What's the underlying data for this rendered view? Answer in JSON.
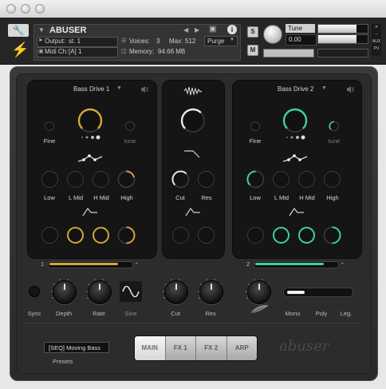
{
  "header": {
    "instrument": "ABUSER",
    "output_label": "Output:",
    "output_value": "st. 1",
    "midi_label": "Midi Ch:",
    "midi_value": "[A] 1",
    "voices_label": "Voices:",
    "voices_value": "3",
    "max_label": "Max:",
    "max_value": "512",
    "memory_label": "Memory:",
    "memory_value": "94.66 MB",
    "purge": "Purge",
    "tune_label": "Tune",
    "tune_value": "0.00",
    "s_btn": "S",
    "m_btn": "M",
    "aux": "AUX",
    "pv": "PV"
  },
  "panels": {
    "left": {
      "title": "Bass Drive 1",
      "fine": "Fine",
      "tune": "tune",
      "low": "Low",
      "lmid": "L Mid",
      "hmid": "H Mid",
      "high": "High",
      "accent": "#d6a53a"
    },
    "middle": {
      "cut": "Cut",
      "res": "Res"
    },
    "right": {
      "title": "Bass Drive 2",
      "fine": "Fine",
      "tune": "tune",
      "low": "Low",
      "lmid": "L Mid",
      "hmid": "H Mid",
      "high": "High",
      "accent": "#3fcfa3"
    }
  },
  "sliders": {
    "left_num": "1",
    "right_num": "2",
    "left_level": 0.85,
    "right_level": 0.85
  },
  "controls": {
    "sync": "Sync",
    "depth": "Depth",
    "rate": "Rate",
    "sine": "Sine",
    "cut": "Cut",
    "res": "Res",
    "mono": "Mono",
    "poly": "Poly",
    "leg": "Leg."
  },
  "preset": {
    "value": "[SEQ] Moving Bass",
    "label": "Presets"
  },
  "tabs": [
    "MAIN",
    "FX 1",
    "FX 2",
    "ARP"
  ],
  "logo": "abuser"
}
